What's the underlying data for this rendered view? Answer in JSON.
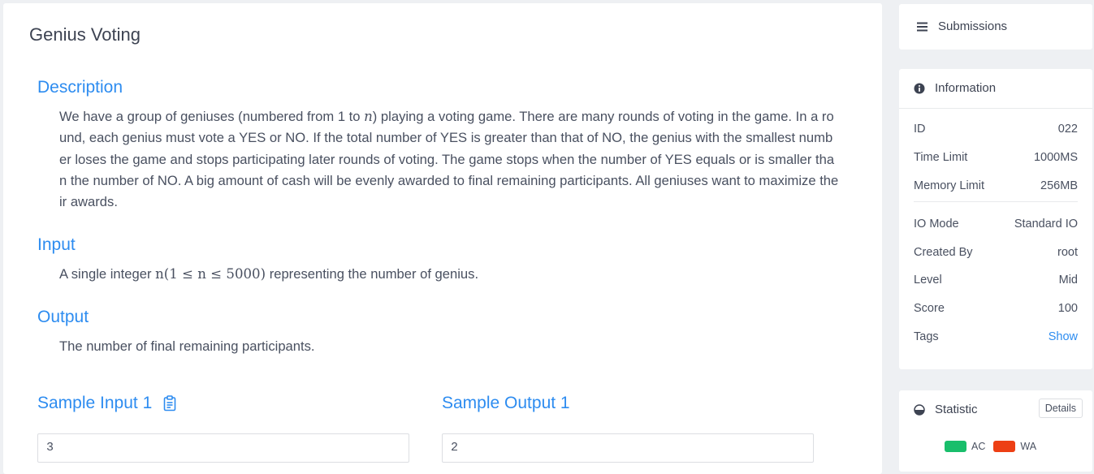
{
  "problem": {
    "title": "Genius Voting",
    "description_heading": "Description",
    "description_parts": {
      "before_n": "We have a group of geniuses (numbered from 1 to ",
      "n": "n",
      "after_n": ") playing a voting game. There are many rounds of voting in the game. In a round, each genius must vote a YES or NO. If the total number of YES is greater than that of NO, the genius with the smallest number loses the game and stops participating later rounds of voting. The game stops when the number of YES equals or is smaller than the number of NO. A big amount of cash will be evenly awarded to final remaining participants. All geniuses want to maximize their awards."
    },
    "input_heading": "Input",
    "input_parts": {
      "before": "A single integer ",
      "math": "n(1 ≤ n ≤ 5000)",
      "after": " representing the number of genius."
    },
    "output_heading": "Output",
    "output_text": "The number of final remaining participants.",
    "sample_input_heading": "Sample Input 1",
    "sample_output_heading": "Sample Output 1",
    "sample_input_value": "3",
    "sample_output_value": "2"
  },
  "sidebar": {
    "submissions_label": "Submissions",
    "information_label": "Information",
    "info_rows": [
      {
        "label": "ID",
        "value": "022"
      },
      {
        "label": "Time Limit",
        "value": "1000MS"
      },
      {
        "label": "Memory Limit",
        "value": "256MB"
      },
      {
        "label": "IO Mode",
        "value": "Standard IO"
      },
      {
        "label": "Created By",
        "value": "root"
      },
      {
        "label": "Level",
        "value": "Mid"
      },
      {
        "label": "Score",
        "value": "100"
      },
      {
        "label": "Tags",
        "value": "Show"
      }
    ],
    "statistic_label": "Statistic",
    "details_label": "Details",
    "legend": [
      {
        "label": "AC",
        "color": "#19be6b"
      },
      {
        "label": "WA",
        "color": "#ed3f14"
      }
    ]
  },
  "colors": {
    "accent": "#2d8cf0",
    "ac": "#19be6b",
    "wa": "#ed3f14"
  },
  "icons": {
    "submissions": "list-icon",
    "information": "info-circle-icon",
    "statistic": "pie-chart-icon",
    "copy": "clipboard-icon"
  }
}
